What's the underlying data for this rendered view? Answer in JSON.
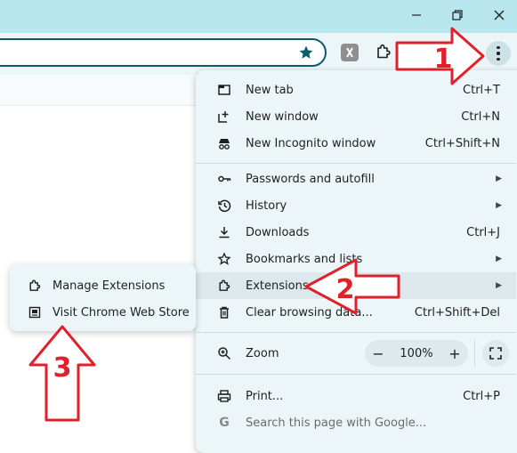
{
  "window": {
    "controls": [
      "minimize",
      "restore",
      "close"
    ]
  },
  "toolbar": {
    "icons": [
      "star-icon",
      "extension-icon",
      "puzzle-icon",
      "menu-icon"
    ]
  },
  "menu": {
    "items": [
      {
        "label": "New tab",
        "shortcut": "Ctrl+T",
        "icon": "new-tab-icon"
      },
      {
        "label": "New window",
        "shortcut": "Ctrl+N",
        "icon": "new-window-icon"
      },
      {
        "label": "New Incognito window",
        "shortcut": "Ctrl+Shift+N",
        "icon": "incognito-icon"
      },
      {
        "label": "Passwords and autofill",
        "shortcut": "",
        "icon": "key-icon",
        "submenu": true
      },
      {
        "label": "History",
        "shortcut": "",
        "icon": "history-icon",
        "submenu": true
      },
      {
        "label": "Downloads",
        "shortcut": "Ctrl+J",
        "icon": "download-icon"
      },
      {
        "label": "Bookmarks and lists",
        "shortcut": "",
        "icon": "star-icon",
        "submenu": true
      },
      {
        "label": "Extensions",
        "shortcut": "",
        "icon": "puzzle-icon",
        "submenu": true,
        "highlighted": true
      },
      {
        "label": "Clear browsing data...",
        "shortcut": "Ctrl+Shift+Del",
        "icon": "trash-icon"
      },
      {
        "label": "Print...",
        "shortcut": "Ctrl+P",
        "icon": "print-icon"
      },
      {
        "label": "Search this page with Google...",
        "shortcut": "",
        "icon": "google-icon"
      }
    ],
    "zoom": {
      "label": "Zoom",
      "value": "100%",
      "minus": "−",
      "plus": "+"
    }
  },
  "submenu": {
    "items": [
      {
        "label": "Manage Extensions",
        "icon": "puzzle-icon"
      },
      {
        "label": "Visit Chrome Web Store",
        "icon": "store-icon"
      }
    ]
  },
  "annotations": {
    "badges": [
      "1",
      "2",
      "3"
    ],
    "color": "#e0202a"
  }
}
